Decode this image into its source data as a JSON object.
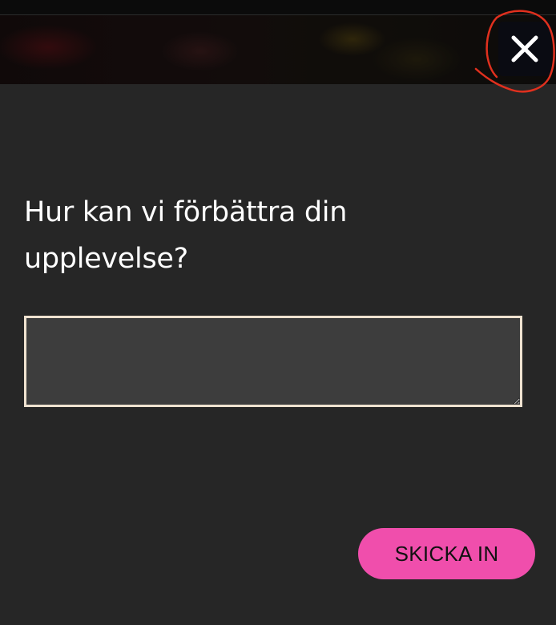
{
  "modal": {
    "question_line_1": "Hur kan vi förbättra din",
    "question_line_2": "upplevelse?",
    "textarea_value": "",
    "submit_label": "SKICKA IN",
    "close_icon": "close-icon"
  },
  "colors": {
    "background": "#262626",
    "textarea_background": "#3d3d3d",
    "textarea_border": "#efe2d0",
    "submit_background": "#f04eac",
    "annotation": "#e0301e"
  }
}
